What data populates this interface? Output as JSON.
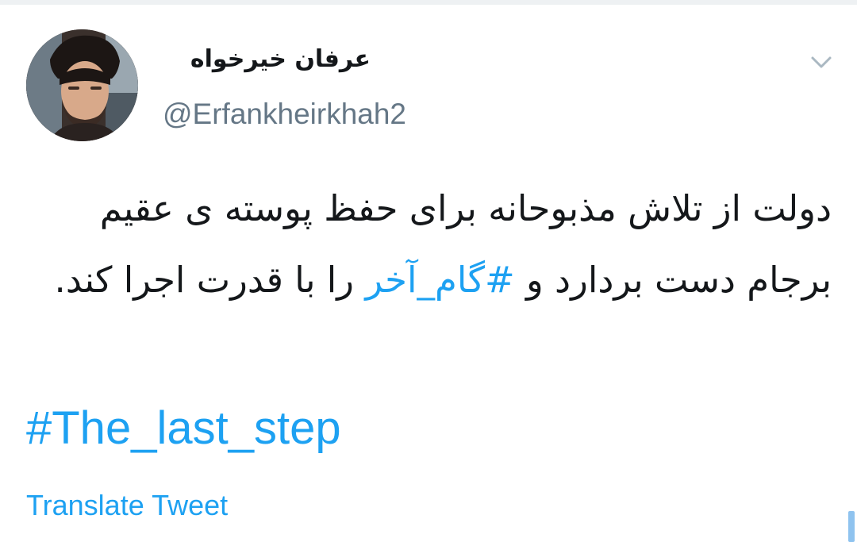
{
  "tweet": {
    "author": {
      "display_name": "عرفان خیرخواه",
      "handle": "@Erfankheirkhah2",
      "avatar": "profile-photo"
    },
    "menu_icon": "chevron-down-icon",
    "text_before_hashtag": "دولت از تلاش مذبوحانه برای حفظ پوسته ی عقیم برجام دست بردارد و ",
    "hashtag_fa": "#گام_آخر",
    "text_after_hashtag": " را با قدرت اجرا کند.",
    "hashtag_en": "#The_last_step",
    "translate_label": "Translate Tweet"
  },
  "colors": {
    "link": "#1da1f2",
    "text": "#14171a",
    "secondary": "#657786",
    "divider": "#eef1f3"
  }
}
